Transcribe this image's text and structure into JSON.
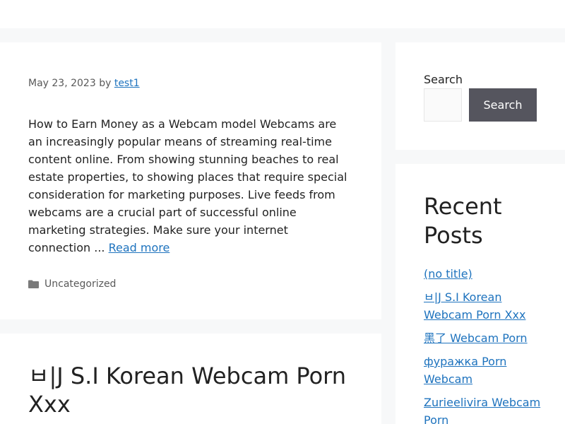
{
  "post1": {
    "date": "May 23, 2023",
    "by": "by",
    "author": "test1",
    "summary": "How to Earn Money as a Webcam model Webcams are an increasingly popular means of streaming real-time content online. From showing stunning beaches to real estate properties, to showing places that require special consideration for marketing purposes. Live feeds from webcams are a crucial part of successful online marketing strategies. Make sure your internet connection ... ",
    "read_more": "Read more",
    "category": "Uncategorized",
    "category_icon": "folder-icon"
  },
  "post2": {
    "title": "ㅂ|J S.I Korean Webcam Porn Xxx"
  },
  "search": {
    "label": "Search",
    "placeholder": "",
    "button_label": "Search"
  },
  "recent_posts": {
    "title": "Recent Posts",
    "items": [
      "(no title)",
      "ㅂ|J S.I Korean Webcam Porn Xxx",
      "黑了 Webcam Porn",
      "фуражка Porn Webcam",
      "Zurieelivira Webcam Porn"
    ]
  },
  "colors": {
    "link": "#1e73be",
    "button_bg": "#55555e",
    "page_bg": "#f7f8f9"
  }
}
